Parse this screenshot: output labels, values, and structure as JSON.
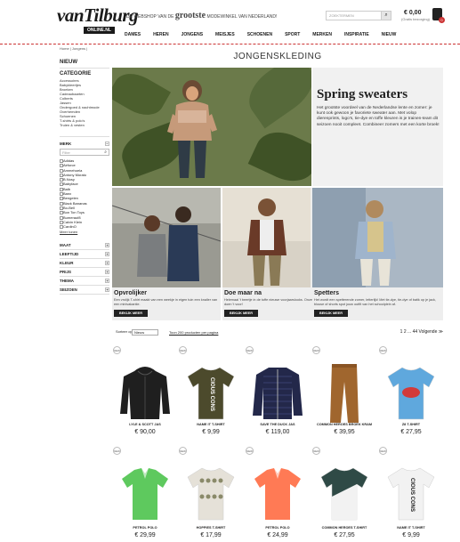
{
  "header": {
    "logo_main": "vanTilburg",
    "logo_sub": "ONLINE.NL",
    "tagline_pre": "DE WEBSHOP VAN DE",
    "tagline_big": "grootste",
    "tagline_post": "MODEWINKEL VAN NEDERLAND!",
    "search_placeholder": "ZOEKTERMEN",
    "cart_total": "€ 0,00",
    "cart_sub": "(Gratis bezorging)",
    "cart_count": "0"
  },
  "nav": [
    "DAMES",
    "HEREN",
    "JONGENS",
    "MEISJES",
    "SCHOENEN",
    "SPORT",
    "MERKEN",
    "INSPIRATIE",
    "NIEUW"
  ],
  "breadcrumb": "Home | Jongens |",
  "page_title": "JONGENSKLEDING",
  "sidebar": {
    "nieuw": "NIEUW",
    "categorie_title": "CATEGORIE",
    "categories": [
      "Accessoires",
      "Babykleertjes",
      "Broeken",
      "Cadeaubaarten",
      "Colberts",
      "Jassen",
      "Ondergoed & nachtmode",
      "Overhemden",
      "Schoenen",
      "T-shirts & polo's",
      "Truien & vesten"
    ],
    "merk_title": "MERK",
    "merk_placeholder": "Filter",
    "brands": [
      "Adidas",
      "Airforce",
      "Ammehoela",
      "Antony Morato",
      "B.Nosy",
      "Babyface",
      "Balb",
      "Banx",
      "Bengelen",
      "Black Bananas",
      "Bo-Bell",
      "Bon Ton Toys",
      "Bumerauf8",
      "Calvin Klein",
      "CardinO"
    ],
    "more_brands": "Meer tonen",
    "filters": [
      "MAAT",
      "LEEFTIJD",
      "KLEUR",
      "PRIJS",
      "THEMA",
      "SEIZOEN"
    ]
  },
  "hero": {
    "title": "Spring sweaters",
    "text": "Het grootste voordeel van de Nederlandse lente en zomer: je kunt ook gewoon je favoriete sweater aan. Met volop dierenprints, logo's, tie-dye en toffe kleuren is je trainen-team dit seizoen nooit compleet. Combineer zomers met een korte broek!"
  },
  "cards": [
    {
      "title": "Opvrolijker",
      "text": "Een vrolijk T-shirt maakt van een weekje in eigen tuin een knaller van een minivakantie.",
      "button": "BEKIJK MEER"
    },
    {
      "title": "Doe maar na",
      "text": "Helemaal 't beertje in de tuffe nieuwe voorjaarslooks. Onze stylisten doen 't voor!",
      "button": "BEKIJK MEER"
    },
    {
      "title": "Spetters",
      "text": "Het wordt een spetterende zomer, letterlijk! Met tie-dye, tie-dye of batik op je jack, blouse of shorts spot jouw outfit van het schoolplein af.",
      "button": "BEKIJK MEER"
    }
  ],
  "sortbar": {
    "label": "Sorteer op",
    "selected": "Nieuw",
    "show_link": "Toon 200 producten per pagina",
    "pagination": "1   2  ...  44    Volgende ≫"
  },
  "badge_new": "NEW",
  "products": [
    {
      "name": "LYLE & SCOTT JAS",
      "price": "€ 90,00",
      "color": "#1f1f1f",
      "type": "hoodie"
    },
    {
      "name": "NAME IT T-SHIRT",
      "price": "€ 9,99",
      "color": "#4c4a2c",
      "type": "tee",
      "print": "CIOUS CONS"
    },
    {
      "name": "SAVE THE DUCK JAS",
      "price": "€ 119,00",
      "color": "#23284a",
      "type": "puffer"
    },
    {
      "name": "COMMON HEROES BROEK KRAM",
      "price": "€ 39,95",
      "color": "#a0662e",
      "type": "pants"
    },
    {
      "name": "Z8 T-SHIRT",
      "price": "€ 27,95",
      "color": "#5fa8dd",
      "type": "tee"
    },
    {
      "name": "PETROL POLO",
      "price": "€ 29,99",
      "color": "#5ec95e",
      "type": "polo"
    },
    {
      "name": "HOPPIES T-SHIRT",
      "price": "€ 17,99",
      "color": "#e5e1d8",
      "type": "tee"
    },
    {
      "name": "PETROL POLO",
      "price": "€ 24,99",
      "color": "#ff7a55",
      "type": "polo"
    },
    {
      "name": "COMMON HEROES T-SHIRT",
      "price": "€ 27,95",
      "color": "#2f4a46",
      "type": "tee"
    },
    {
      "name": "NAME IT T-SHIRT",
      "price": "€ 9,99",
      "color": "#f2f2f2",
      "type": "tee",
      "print": "CIOUS CONS"
    }
  ]
}
